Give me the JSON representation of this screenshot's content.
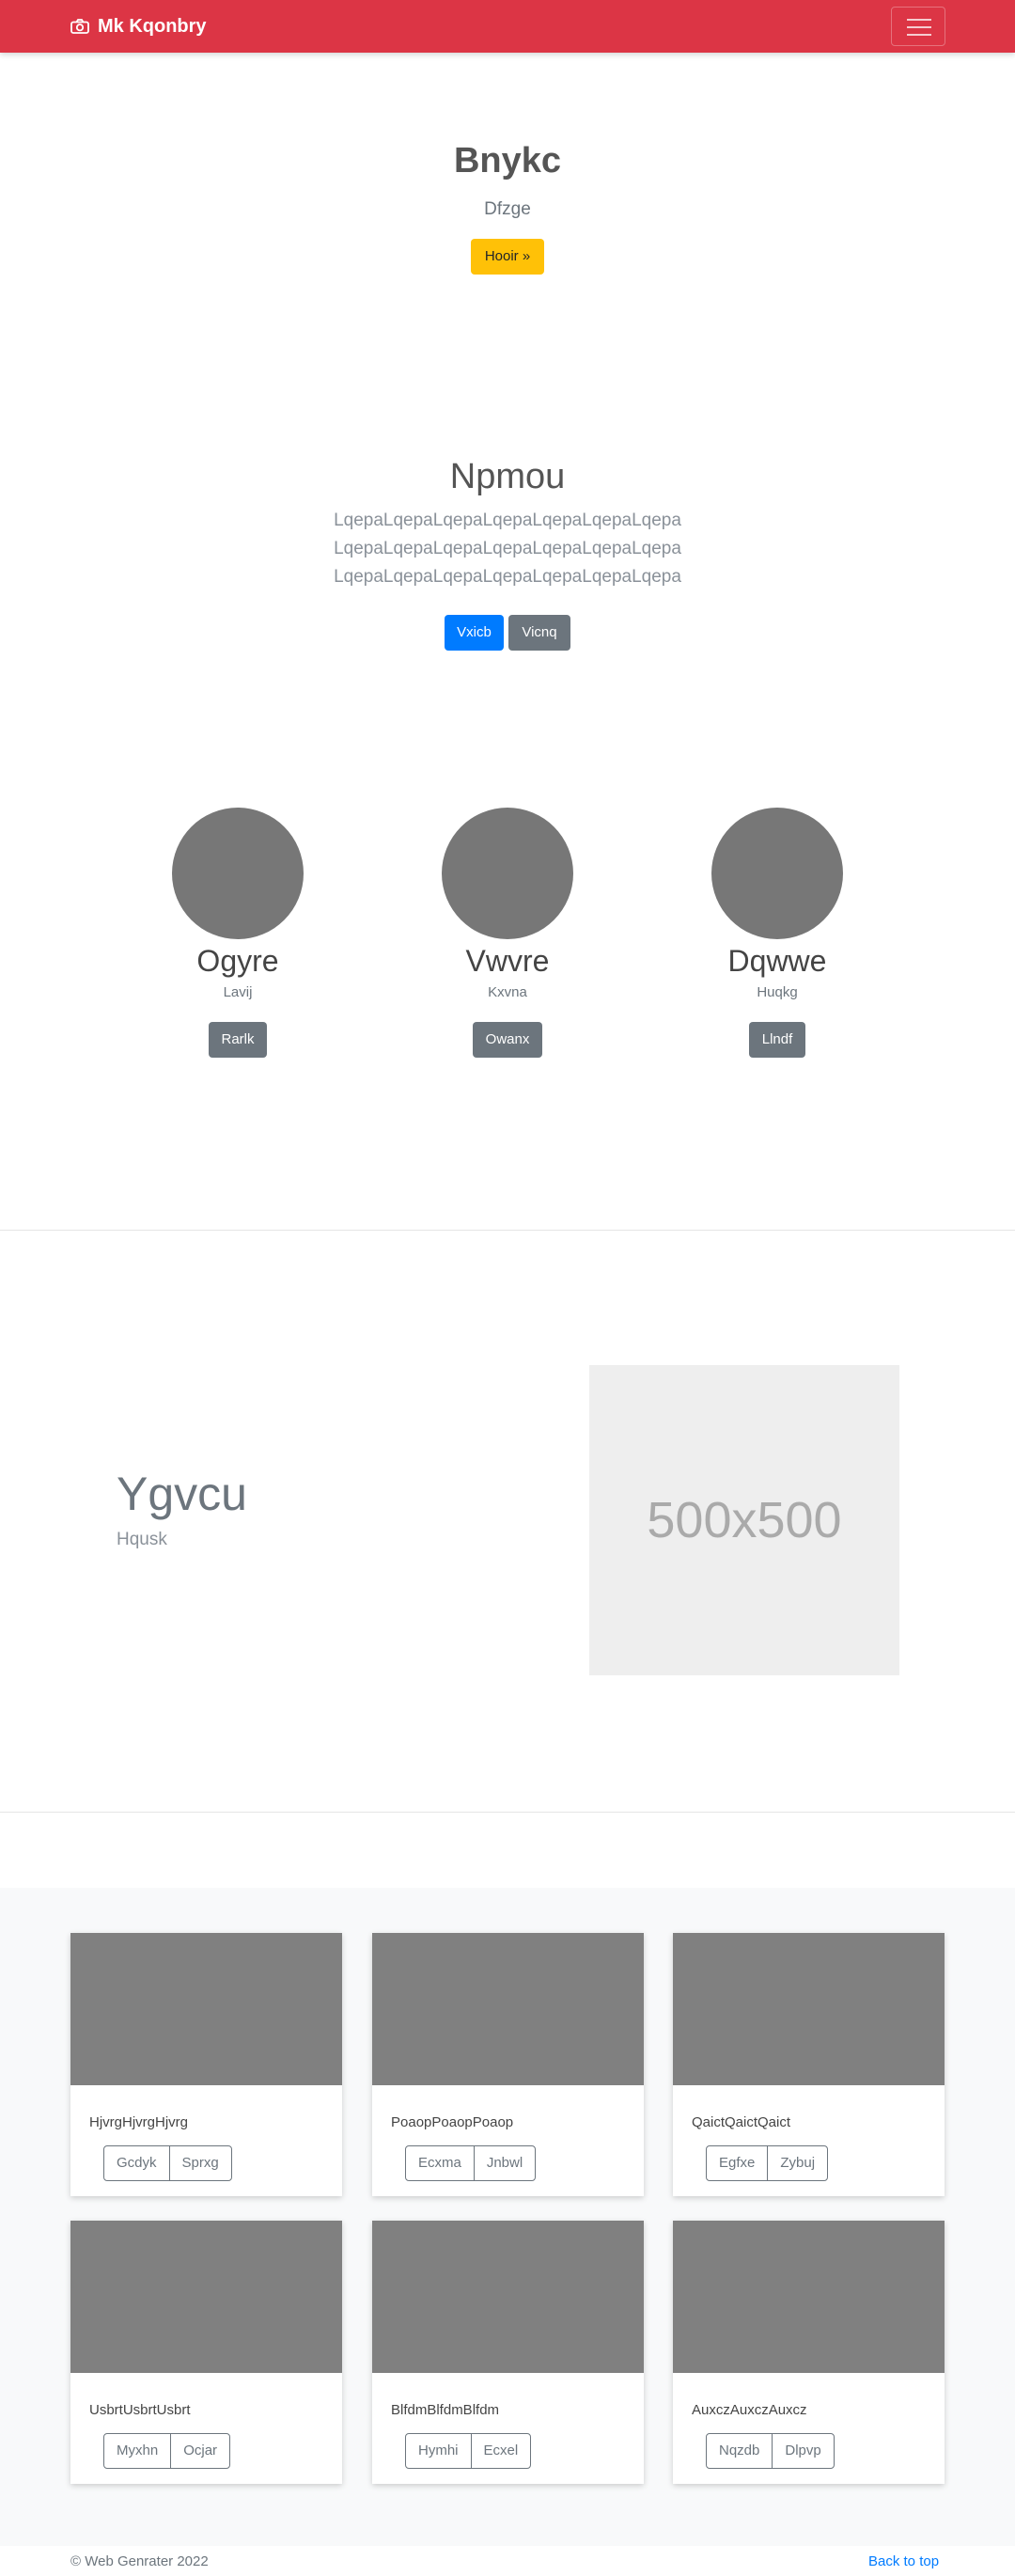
{
  "navbar": {
    "brand": "Mk Kqonbry",
    "brand_icon": "camera-icon",
    "menu_icon": "hamburger-menu-icon",
    "color": "#dc3545"
  },
  "hero": {
    "title": "Bnykc",
    "subtitle": "Dfzge",
    "button": "Hooir »"
  },
  "section": {
    "title": "Npmou",
    "lines": [
      "LqepaLqepaLqepaLqepaLqepaLqepaLqepa",
      "LqepaLqepaLqepaLqepaLqepaLqepaLqepa",
      "LqepaLqepaLqepaLqepaLqepaLqepaLqepa"
    ],
    "primary_button": "Vxicb",
    "secondary_button": "Vicnq"
  },
  "profiles": [
    {
      "name": "Ogyre",
      "sub": "Lavij",
      "button": "Rarlk"
    },
    {
      "name": "Vwvre",
      "sub": "Kxvna",
      "button": "Owanx"
    },
    {
      "name": "Dqwwe",
      "sub": "Huqkg",
      "button": "Llndf"
    }
  ],
  "feature": {
    "title": "Ygvcu",
    "subtitle": "Hqusk",
    "placeholder": "500x500"
  },
  "cards": [
    {
      "text": "HjvrgHjvrgHjvrg",
      "buttons": [
        "Gcdyk",
        "Sprxg"
      ]
    },
    {
      "text": "PoaopPoaopPoaop",
      "buttons": [
        "Ecxma",
        "Jnbwl"
      ]
    },
    {
      "text": "QaictQaictQaict",
      "buttons": [
        "Egfxe",
        "Zybuj"
      ]
    },
    {
      "text": "UsbrtUsbrtUsbrt",
      "buttons": [
        "Myxhn",
        "Ocjar"
      ]
    },
    {
      "text": "BlfdmBlfdmBlfdm",
      "buttons": [
        "Hymhi",
        "Ecxel"
      ]
    },
    {
      "text": "AuxczAuxczAuxcz",
      "buttons": [
        "Nqzdb",
        "Dlpvp"
      ]
    }
  ],
  "footer": {
    "copyright": "© Web Genrater 2022",
    "back_to_top": "Back to top"
  }
}
